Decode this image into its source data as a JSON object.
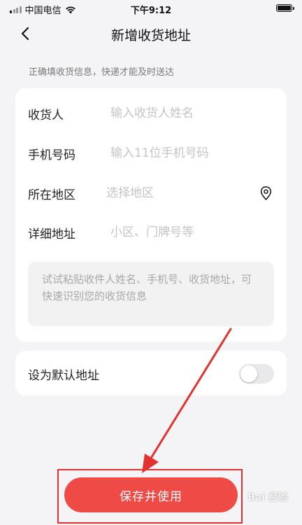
{
  "status_bar": {
    "carrier": "中国电信",
    "time": "下午9:12"
  },
  "nav": {
    "title": "新增收货地址",
    "back_icon": "chevron-left-icon"
  },
  "hint": "正确填收货信息，快递才能及时送达",
  "form": {
    "recipient": {
      "label": "收货人",
      "placeholder": "输入收货人姓名",
      "value": ""
    },
    "phone": {
      "label": "手机号码",
      "placeholder": "输入11位手机号码",
      "value": ""
    },
    "region": {
      "label": "所在地区",
      "placeholder": "选择地区",
      "value": "",
      "icon": "location-pin-icon"
    },
    "detail": {
      "label": "详细地址",
      "placeholder": "小区、门牌号等",
      "value": ""
    },
    "paste_hint": "试试粘贴收件人姓名、手机号、收货地址，可快速识别您的收货信息"
  },
  "default_address": {
    "label": "设为默认地址",
    "enabled": false
  },
  "save_button": "保存并使用",
  "watermark": "Bai 经验",
  "colors": {
    "accent": "#ee4a46",
    "annotation": "#e33131",
    "background": "#f4f4f6"
  }
}
